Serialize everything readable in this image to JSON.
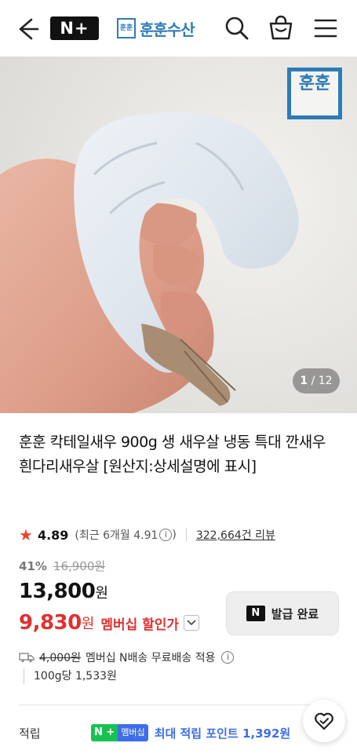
{
  "header": {
    "brand_badge": "N+",
    "store_name": "훈훈수산",
    "store_logo_text": "훈훈"
  },
  "hero": {
    "watermark_text": "훈훈",
    "counter_current": "1",
    "counter_total": "/ 12"
  },
  "product": {
    "title": "훈훈 칵테일새우 900g 생 새우살 냉동 특대 깐새우 흰다리새우살 [원산지:상세설명에 표시]",
    "rating": "4.89",
    "recent_rating": "(최근 6개월 4.91",
    "info_symbol": "i",
    "recent_close": ")",
    "review_count": "322,664건 리뷰",
    "discount_pct": "41%",
    "original_price": "16,900원",
    "price": "13,800",
    "price_unit": "원",
    "member_price": "9,830",
    "member_unit": "원",
    "member_label": "멤버십 할인가",
    "coupon_badge": "N",
    "coupon_label": "발급 완료"
  },
  "shipping": {
    "old_fee": "4,000원",
    "text": "멤버십 N배송 무료배송 적용",
    "info_symbol": "i",
    "per_unit": "100g당 1,533원"
  },
  "points": {
    "label": "적립",
    "badge_n": "N +",
    "badge_member": "멤버십",
    "text": "최대 적립 포인트 1,392원"
  },
  "colors": {
    "brand_blue": "#2f7bb8",
    "sale_red": "#e03030",
    "star": "#e8472c",
    "point_blue": "#3d6ee8",
    "naver_green": "#19c153"
  }
}
